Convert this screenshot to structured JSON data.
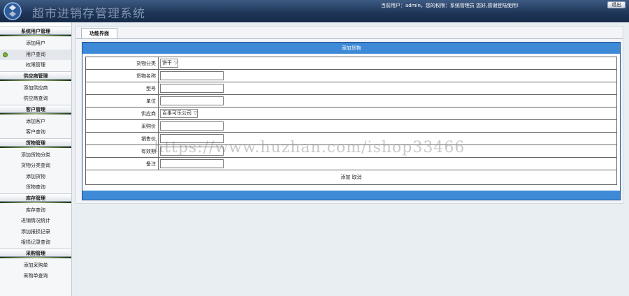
{
  "header": {
    "title": "超市进销存管理系统",
    "user_info": "当前用户：admin，您的权限：系统管理员 您好,感谢登陆使用!",
    "logout_label": "退出"
  },
  "sidebar": {
    "sections": [
      {
        "title": "系统用户管理",
        "items": [
          "添加用户",
          "用户查询",
          "权限管理"
        ],
        "active": 1
      },
      {
        "title": "供应商管理",
        "items": [
          "添加供应商",
          "供应商查询"
        ]
      },
      {
        "title": "客户管理",
        "items": [
          "添加客户",
          "客户查询"
        ]
      },
      {
        "title": "货物管理",
        "items": [
          "添加货物分类",
          "货物分类查询",
          "添加货物",
          "货物查询"
        ]
      },
      {
        "title": "库存管理",
        "items": [
          "库存查询",
          "进销情况统计",
          "添加报损记录",
          "报损记录查询"
        ]
      },
      {
        "title": "采购管理",
        "items": [
          "添加采购单",
          "采购单查询"
        ]
      }
    ]
  },
  "main": {
    "tab_label": "功能界面",
    "panel_title": "添加货物",
    "fields": [
      {
        "label": "货物分类",
        "type": "select",
        "value": "饼干"
      },
      {
        "label": "货物名称",
        "type": "text",
        "value": ""
      },
      {
        "label": "型号",
        "type": "text",
        "value": ""
      },
      {
        "label": "单位",
        "type": "text",
        "value": ""
      },
      {
        "label": "供应商",
        "type": "select",
        "value": "百事可乐公司"
      },
      {
        "label": "采购价",
        "type": "text",
        "value": ""
      },
      {
        "label": "销售价",
        "type": "text",
        "value": ""
      },
      {
        "label": "有效期",
        "type": "text",
        "value": ""
      },
      {
        "label": "备注",
        "type": "text",
        "value": ""
      }
    ],
    "add_label": "添加",
    "cancel_label": "取消"
  },
  "watermark": "https://www.huzhan.com/ishop33466",
  "colors": {
    "header_dark": "#1e3558",
    "panel_blue": "#3e8ad7",
    "bullet_green": "#7fb032"
  }
}
